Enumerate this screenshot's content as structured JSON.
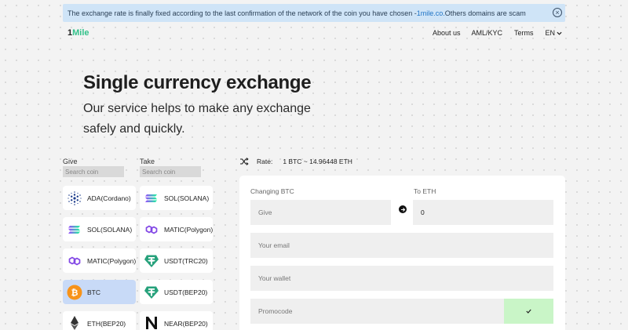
{
  "notice": {
    "text_before": "The exchange rate is finally fixed according to the last confirmation of the network of the coin you have chosen - ",
    "domain": "1mile.co.",
    "text_after": " Others domains are scam"
  },
  "brand": {
    "prefix": "1",
    "name": "Mile"
  },
  "nav": {
    "about": "About us",
    "aml": "AML/KYC",
    "terms": "Terms",
    "lang": "EN"
  },
  "hero": {
    "title": "Single currency exchange",
    "subtitle": "Our service helps to make any exchange safely and quickly."
  },
  "give": {
    "label": "Give",
    "search_placeholder": "Search coin",
    "coins": [
      {
        "label": "ADA(Cordano)",
        "icon": "cardano-icon",
        "selected": false
      },
      {
        "label": "SOL(SOLANA)",
        "icon": "solana-icon",
        "selected": false
      },
      {
        "label": "MATIC(Polygon)",
        "icon": "polygon-icon",
        "selected": false
      },
      {
        "label": "BTC",
        "icon": "bitcoin-icon",
        "selected": true
      },
      {
        "label": "ETH(BEP20)",
        "icon": "ethereum-icon",
        "selected": false
      }
    ]
  },
  "take": {
    "label": "Take",
    "search_placeholder": "Search coin",
    "coins": [
      {
        "label": "SOL(SOLANA)",
        "icon": "solana-icon",
        "selected": false
      },
      {
        "label": "MATIC(Polygon)",
        "icon": "polygon-icon",
        "selected": false
      },
      {
        "label": "USDT(TRC20)",
        "icon": "tether-icon",
        "selected": false
      },
      {
        "label": "USDT(BEP20)",
        "icon": "tether-icon",
        "selected": false
      },
      {
        "label": "NEAR(BEP20)",
        "icon": "near-icon",
        "selected": false
      }
    ]
  },
  "rate": {
    "label": "Rate:",
    "value": "1 BTC ~ 14.96448 ETH"
  },
  "form": {
    "changing_label": "Changing BTC",
    "to_label": "To ETH",
    "give_placeholder": "Give",
    "take_value": "0",
    "email_placeholder": "Your email",
    "wallet_placeholder": "Your wallet",
    "promo_placeholder": "Promocode"
  },
  "colors": {
    "accent_green": "#33c18a",
    "notice_bg": "#cfe4f7",
    "selected_coin_bg": "#c8daf7",
    "promo_button_bg": "#c9f5c7"
  }
}
